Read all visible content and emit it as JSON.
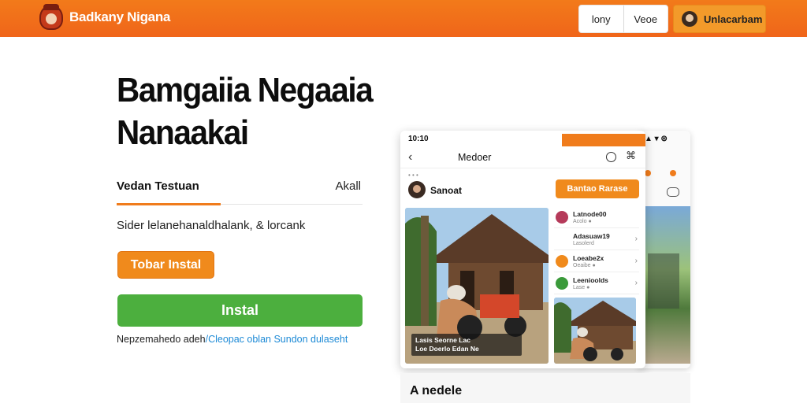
{
  "header": {
    "brand_name": "Badkany Nigana",
    "nav": [
      "lony",
      "Veoe"
    ],
    "user_label": "Unlacarbam"
  },
  "hero": {
    "title_line1": "Bamgaiia Negaaia",
    "title_line2": "Nanaakai",
    "tab_active": "Vedan Testuan",
    "tab_all": "Akall",
    "description": "Sider lelanehanaldhalank, & lorcank",
    "try_button": "Tobar Instal",
    "install_button": "Instal",
    "note_text": "Nepzemahedo adeh",
    "note_link": "/Cleopac oblan Sundon dulaseht"
  },
  "phone": {
    "status_time": "10:10",
    "app_title": "Medoer",
    "profile_name": "Sanoat",
    "follow_button": "Bantao Rarase",
    "list": [
      {
        "label": "Latnode00",
        "sub": "Acolo ●",
        "color": "#b53a5a"
      },
      {
        "label": "Adasuaw19",
        "sub": "Lasolerd",
        "color": "#ffffff"
      },
      {
        "label": "Loeabe2x",
        "sub": "Oeaibe ●",
        "color": "#f08a1c"
      },
      {
        "label": "Leenioolds",
        "sub": "Lase ●",
        "color": "#3a9a3a"
      }
    ],
    "caption": "Lasis Seorne Lac\nLoe Doerlo Edan Ne"
  },
  "below_title": "A nedele",
  "colors": {
    "header": "#f27a1a",
    "accent": "#f08a1c",
    "install": "#4caf3e",
    "link": "#1d8ad6"
  }
}
